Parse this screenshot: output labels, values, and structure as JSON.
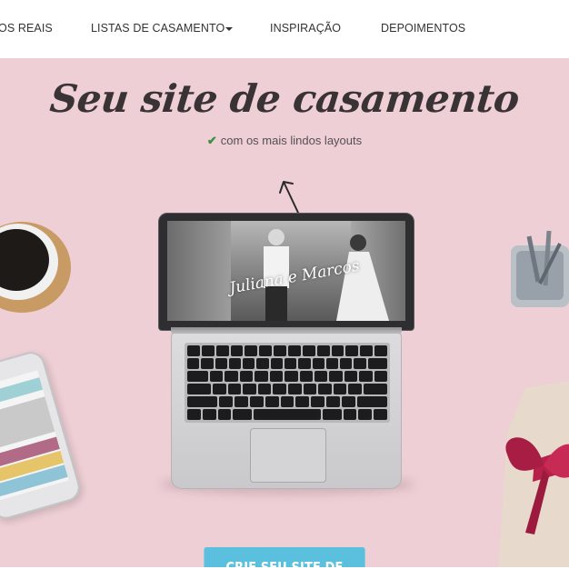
{
  "nav": {
    "items": [
      {
        "label": "OS REAIS"
      },
      {
        "label": "LISTAS DE CASAMENTO"
      },
      {
        "label": "INSPIRAÇÃO"
      },
      {
        "label": "DEPOIMENTOS"
      }
    ]
  },
  "hero": {
    "title": "Seu site de casamento",
    "subtitle": "com os mais lindos layouts",
    "couple_names": "Juliana e Marcos",
    "cta_label": "CRIE SEU SITE DE CASAMENTO"
  },
  "colors": {
    "hero_bg": "#edcfd5",
    "check": "#3e8e41",
    "cta": "#5bc0de"
  }
}
